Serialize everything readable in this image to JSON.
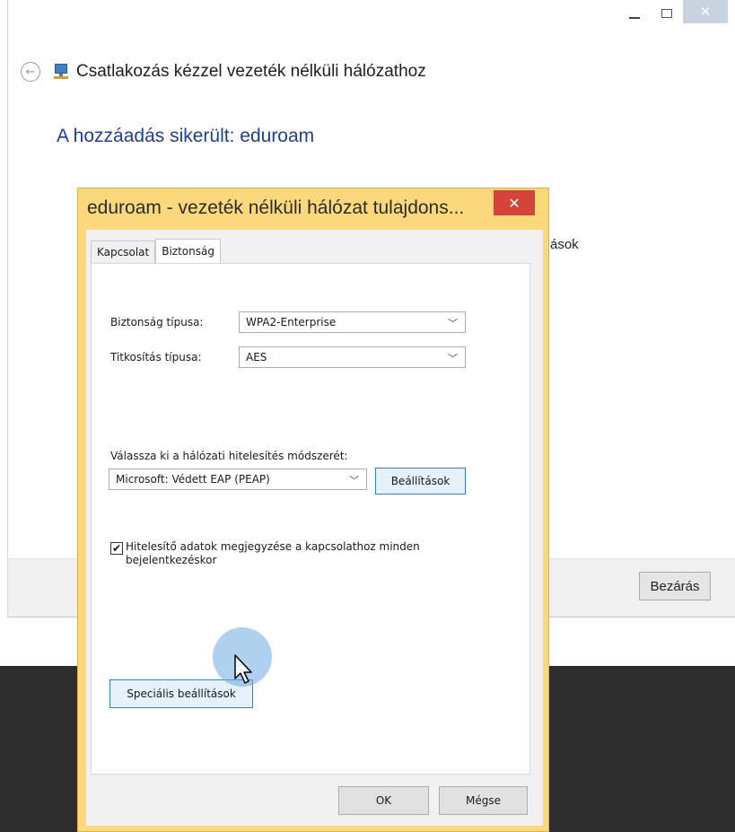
{
  "wizard": {
    "title": "Csatlakozás kézzel vezeték nélküli hálózathoz",
    "heading": "A hozzáadás sikerült: eduroam",
    "partial_text": "ások",
    "close_button": "Bezárás",
    "window_controls": {
      "minimize_icon": "minimize-icon",
      "maximize_icon": "maximize-icon",
      "close_icon": "close-icon"
    },
    "back_icon": "back-arrow-icon",
    "network_icon": "network-icon"
  },
  "dialog": {
    "title": "eduroam - vezeték nélküli hálózat tulajdons...",
    "close_glyph": "✕",
    "tabs": [
      {
        "label": "Kapcsolat",
        "active": false
      },
      {
        "label": "Biztonság",
        "active": true
      }
    ],
    "security_type": {
      "label": "Biztonság típusa:",
      "value": "WPA2-Enterprise"
    },
    "encryption_type": {
      "label": "Titkosítás típusa:",
      "value": "AES"
    },
    "auth_method": {
      "label": "Válassza ki a hálózati hitelesítés módszerét:",
      "value": "Microsoft: Védett EAP (PEAP)",
      "settings_button": "Beállítások"
    },
    "remember_credentials": {
      "checked": true,
      "label": "Hitelesítő adatok megjegyzése a kapcsolathoz minden bejelentkezéskor"
    },
    "advanced_button": "Speciális beállítások",
    "ok_button": "OK",
    "cancel_button": "Mégse"
  },
  "colors": {
    "dialog_frame": "#fbd87c",
    "close_red": "#d3443a",
    "heading_blue": "#1f3f8f",
    "focus_blue": "#3c7fb1"
  }
}
